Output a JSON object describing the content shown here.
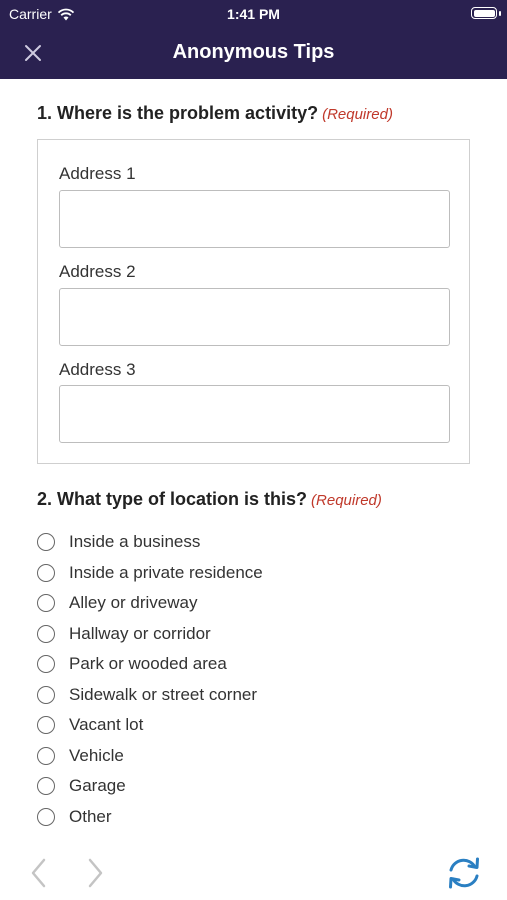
{
  "status_bar": {
    "carrier": "Carrier",
    "time": "1:41 PM"
  },
  "nav": {
    "title": "Anonymous Tips",
    "close_icon": "close-icon"
  },
  "colors": {
    "nav_bg": "#2a2150",
    "required": "#c0392b",
    "refresh": "#2a7fc2"
  },
  "question1": {
    "title": "1. Where is the problem activity?",
    "required": "(Required)",
    "fields": [
      {
        "label": "Address 1",
        "value": "",
        "placeholder": ""
      },
      {
        "label": "Address 2",
        "value": "",
        "placeholder": ""
      },
      {
        "label": "Address 3",
        "value": "",
        "placeholder": ""
      }
    ]
  },
  "question2": {
    "title": "2. What type of location is this?",
    "required": "(Required)",
    "options": [
      "Inside a business",
      "Inside a private residence",
      "Alley or driveway",
      "Hallway or corridor",
      "Park or wooded area",
      "Sidewalk or street corner",
      "Vacant lot",
      "Vehicle",
      "Garage",
      "Other"
    ]
  },
  "toolbar": {
    "prev_icon": "chevron-left-icon",
    "next_icon": "chevron-right-icon",
    "refresh_icon": "refresh-icon"
  }
}
